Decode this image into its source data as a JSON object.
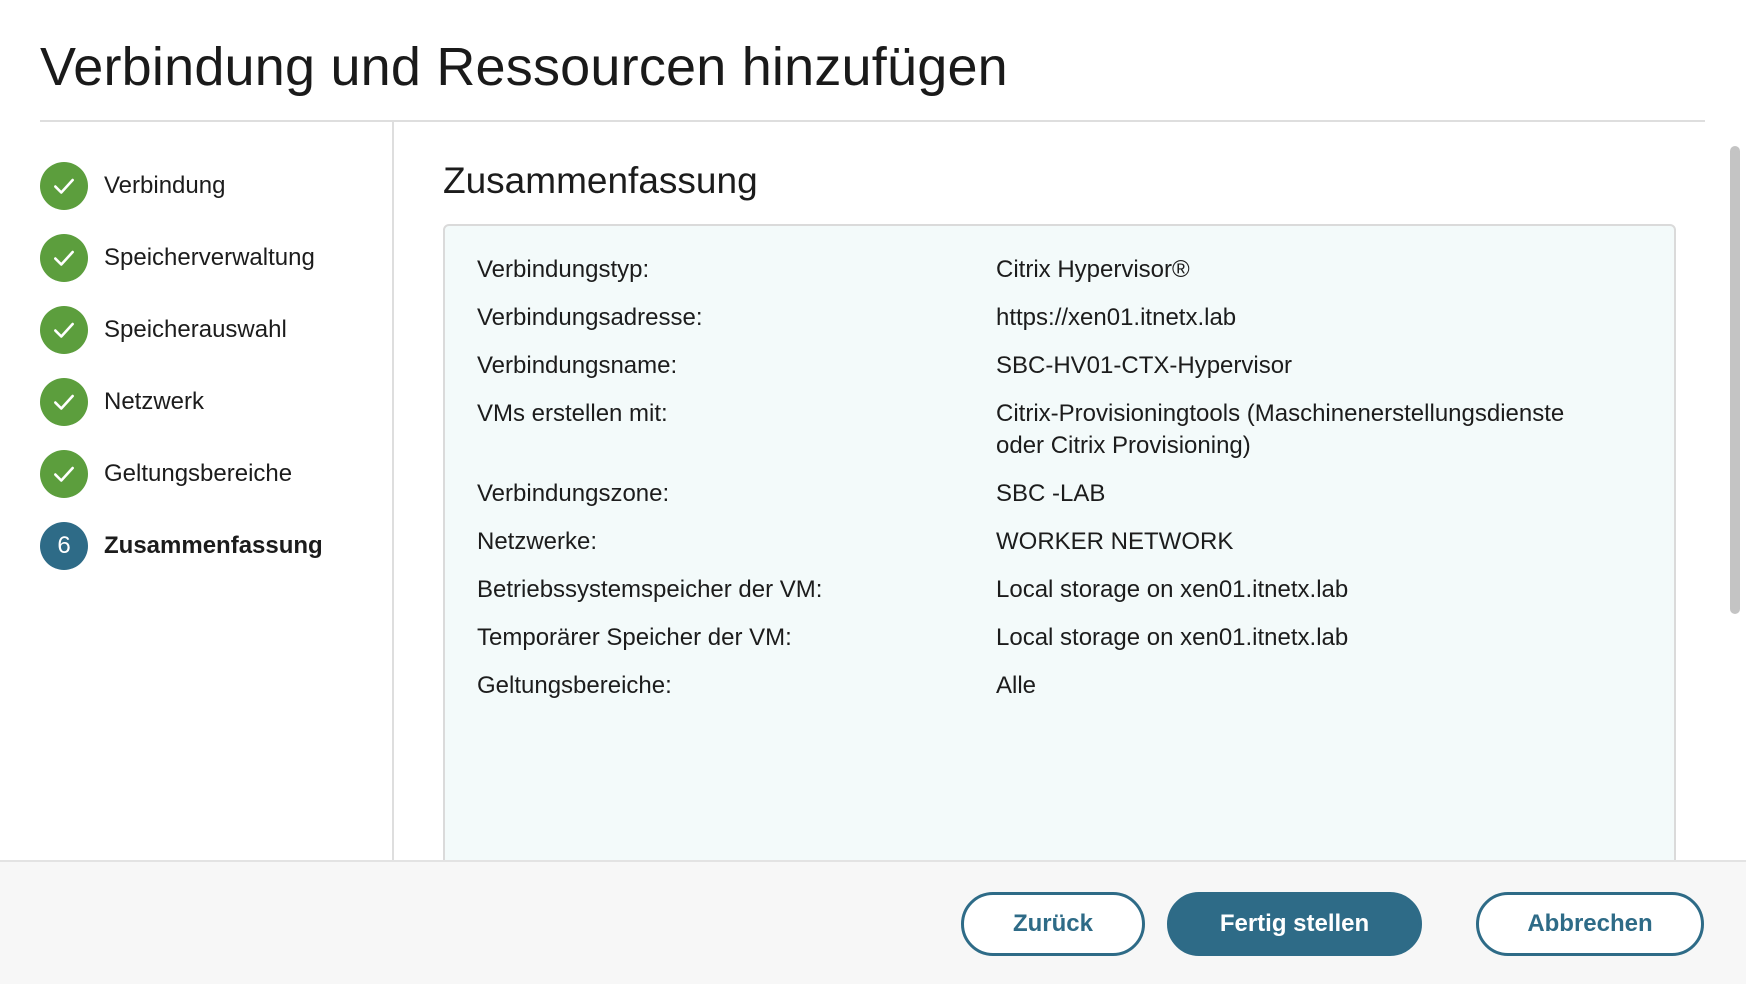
{
  "dialog": {
    "title": "Verbindung und Ressourcen hinzufügen"
  },
  "steps": [
    {
      "label": "Verbindung",
      "status": "done"
    },
    {
      "label": "Speicherverwaltung",
      "status": "done"
    },
    {
      "label": "Speicherauswahl",
      "status": "done"
    },
    {
      "label": "Netzwerk",
      "status": "done"
    },
    {
      "label": "Geltungsbereiche",
      "status": "done"
    },
    {
      "label": "Zusammenfassung",
      "status": "current",
      "number": "6"
    }
  ],
  "summary": {
    "title": "Zusammenfassung",
    "rows": [
      {
        "key": "Verbindungstyp:",
        "value": "Citrix Hypervisor®"
      },
      {
        "key": "Verbindungsadresse:",
        "value": "https://xen01.itnetx.lab"
      },
      {
        "key": "Verbindungsname:",
        "value": "SBC-HV01-CTX-Hypervisor"
      },
      {
        "key": "VMs erstellen mit:",
        "value": "Citrix-Provisioningtools (Maschinenerstellungsdienste oder Citrix Provisioning)"
      },
      {
        "key": "Verbindungszone:",
        "value": "SBC -LAB"
      },
      {
        "key": "Netzwerke:",
        "value": "WORKER NETWORK"
      },
      {
        "key": "Betriebssystemspeicher der VM:",
        "value": "Local storage on xen01.itnetx.lab"
      },
      {
        "key": "Temporärer Speicher der VM:",
        "value": "Local storage on xen01.itnetx.lab"
      },
      {
        "key": "Geltungsbereiche:",
        "value": "Alle"
      }
    ]
  },
  "footer": {
    "back_label": "Zurück",
    "finish_label": "Fertig stellen",
    "cancel_label": "Abbrechen"
  },
  "colors": {
    "accent": "#2e6b87",
    "done_green": "#5c9e3d",
    "summary_bg": "#f3fafa"
  },
  "icons": {
    "done_step": "checkmark-icon"
  }
}
